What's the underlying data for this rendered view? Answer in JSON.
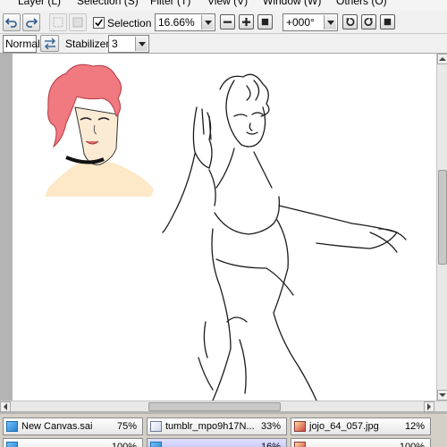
{
  "menubar": {
    "items": [
      "Layer (L)",
      "Selection (S)",
      "Filter (T)",
      "View (V)",
      "Window (W)",
      "Others (O)"
    ]
  },
  "toolbar": {
    "selection_label": "Selection",
    "selection_checked": true,
    "zoom_value": "16.66%",
    "rotation_value": "+000°",
    "blend_mode": "Normal",
    "stabilizer_label": "Stabilizer",
    "stabilizer_value": "3"
  },
  "icons": {
    "undo": "undo-icon",
    "redo": "redo-icon",
    "deselect": "deselect-icon",
    "select_all": "select-all-icon",
    "zoom_out": "zoom-out-icon",
    "zoom_in": "zoom-in-icon",
    "zoom_reset": "zoom-reset-icon",
    "rotate_left": "rotate-left-icon",
    "rotate_right": "rotate-right-icon",
    "rotate_reset": "rotate-reset-icon",
    "flip": "flip-horizontal-icon"
  },
  "canvas": {
    "vertical_scroll_fraction": 0.35,
    "horizontal_scroll_fraction": 0.37
  },
  "tabs": {
    "row1": [
      {
        "name": "New Canvas.sai",
        "zoom": "75%"
      },
      {
        "name": "tumblr_mpo9h17N...",
        "zoom": "33%"
      },
      {
        "name": "jojo_64_057.jpg",
        "zoom": "12%"
      }
    ],
    "row2": [
      {
        "name": "",
        "zoom": "100%"
      },
      {
        "name": "",
        "zoom": "16%",
        "active": true
      },
      {
        "name": "",
        "zoom": "100%"
      }
    ]
  },
  "colors": {
    "hair": "#f07a80",
    "skin": "#fde8c8",
    "active_tab": "#c0c0f8"
  }
}
